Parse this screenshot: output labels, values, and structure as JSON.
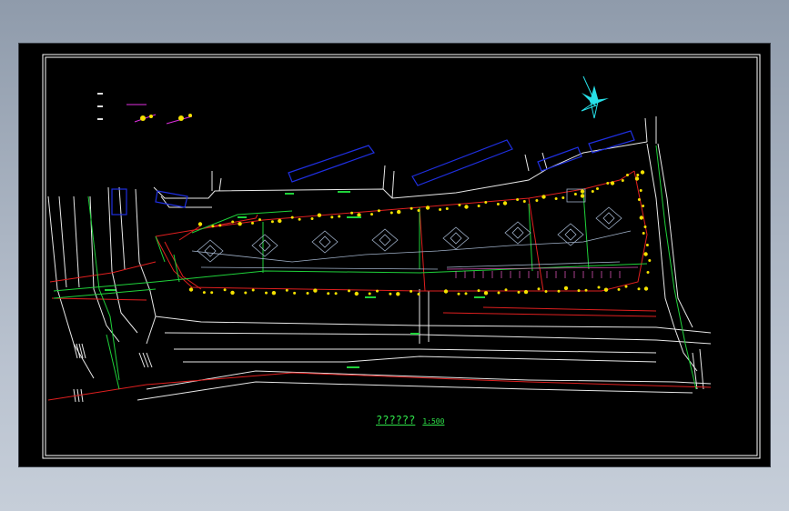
{
  "drawing": {
    "title": "??????",
    "scale": "1:500"
  },
  "colors": {
    "background": "#000000",
    "frame": "#ffffff",
    "road": "#e8e8e8",
    "boundary": "#e01f1f",
    "building": "#1f2fe0",
    "pipeline": "#1fd23a",
    "annotation": "#f4e100",
    "compass": "#27e0e8",
    "legend_line": "#e02fe0",
    "caption": "#2fe44a"
  },
  "icons": [
    "north-arrow-icon"
  ]
}
